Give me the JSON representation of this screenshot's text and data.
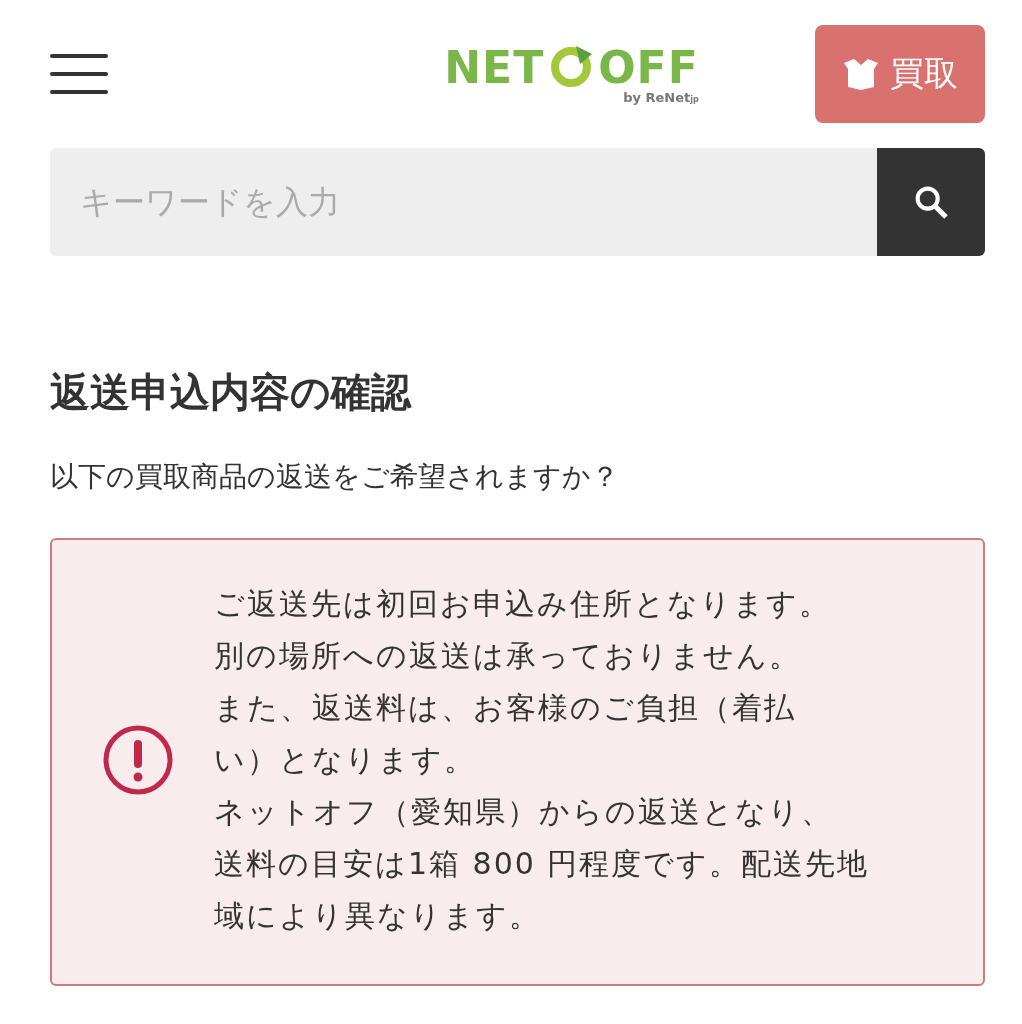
{
  "header": {
    "logo": {
      "left": "NET",
      "right": "OFF",
      "byline": "by ReNet",
      "suffix": "jp"
    },
    "buy_button": "買取"
  },
  "search": {
    "placeholder": "キーワードを入力"
  },
  "title": "返送申込内容の確認",
  "question": "以下の買取商品の返送をご希望されますか？",
  "notice": {
    "lines": [
      "ご返送先は初回お申込み住所となります。",
      "別の場所への返送は承っておりません。",
      "また、返送料は、お客様のご負担（着払",
      "い）となります。",
      "ネットオフ（愛知県）からの返送となり、",
      "送料の目安は1箱 800 円程度です。配送先地",
      "域により異なります。"
    ]
  }
}
